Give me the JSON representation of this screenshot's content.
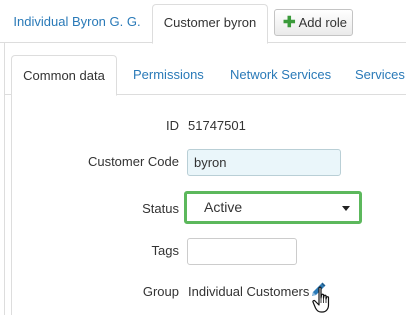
{
  "top_tabs": [
    {
      "label": "Individual Byron G. G."
    },
    {
      "label": "Customer byron"
    }
  ],
  "add_role": {
    "label": "Add role",
    "icon": "plus-icon"
  },
  "sub_tabs": [
    {
      "label": "Common data"
    },
    {
      "label": "Permissions"
    },
    {
      "label": "Network Services"
    },
    {
      "label": "Services"
    }
  ],
  "form": {
    "id": {
      "label": "ID",
      "value": "51747501"
    },
    "customer_code": {
      "label": "Customer Code",
      "value": "byron"
    },
    "status": {
      "label": "Status",
      "value": "Active"
    },
    "tags": {
      "label": "Tags",
      "value": ""
    },
    "group": {
      "label": "Group",
      "value": "Individual Customers"
    }
  },
  "colors": {
    "link": "#2a7ab8",
    "status_highlight": "#5cb85c",
    "code_field_bg": "#eaf6fa",
    "plus": "#3a9a3a"
  }
}
